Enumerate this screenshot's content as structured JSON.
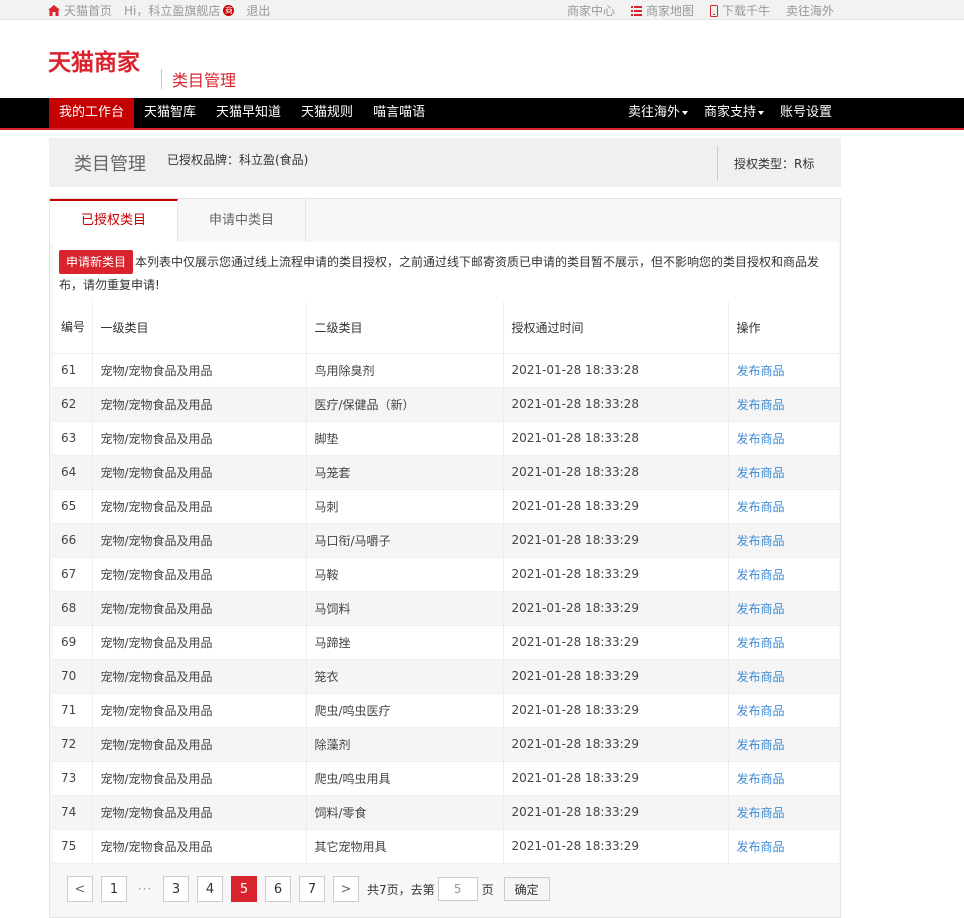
{
  "topbar": {
    "home": "天猫首页",
    "greeting": "Hi，科立盈旗舰店",
    "badge": "商",
    "logout": "退出",
    "links": [
      "商家中心",
      "商家地图",
      "下载千牛",
      "卖往海外"
    ]
  },
  "header": {
    "logo": "天猫商家",
    "subtitle": "类目管理"
  },
  "nav": {
    "left": [
      "我的工作台",
      "天猫智库",
      "天猫早知道",
      "天猫规则",
      "喵言喵语"
    ],
    "right": [
      "卖往海外",
      "商家支持",
      "账号设置"
    ]
  },
  "page": {
    "title": "类目管理",
    "brand": "已授权品牌：科立盈(食品)",
    "auth_type": "授权类型：R标"
  },
  "tabs": [
    "已授权类目",
    "申请中类目"
  ],
  "notice": {
    "button": "申请新类目",
    "text": "本列表中仅展示您通过线上流程申请的类目授权，之前通过线下邮寄资质已申请的类目暂不展示，但不影响您的类目授权和商品发布，请勿重复申请!"
  },
  "table": {
    "headers": [
      "编号",
      "一级类目",
      "二级类目",
      "授权通过时间",
      "操作"
    ],
    "rows": [
      {
        "no": "61",
        "l1": "宠物/宠物食品及用品",
        "l2": "鸟用除臭剂",
        "time": "2021-01-28 18:33:28",
        "action": "发布商品"
      },
      {
        "no": "62",
        "l1": "宠物/宠物食品及用品",
        "l2": "医疗/保健品（新）",
        "time": "2021-01-28 18:33:28",
        "action": "发布商品"
      },
      {
        "no": "63",
        "l1": "宠物/宠物食品及用品",
        "l2": "脚垫",
        "time": "2021-01-28 18:33:28",
        "action": "发布商品"
      },
      {
        "no": "64",
        "l1": "宠物/宠物食品及用品",
        "l2": "马笼套",
        "time": "2021-01-28 18:33:28",
        "action": "发布商品"
      },
      {
        "no": "65",
        "l1": "宠物/宠物食品及用品",
        "l2": "马刺",
        "time": "2021-01-28 18:33:29",
        "action": "发布商品"
      },
      {
        "no": "66",
        "l1": "宠物/宠物食品及用品",
        "l2": "马口衔/马嚼子",
        "time": "2021-01-28 18:33:29",
        "action": "发布商品"
      },
      {
        "no": "67",
        "l1": "宠物/宠物食品及用品",
        "l2": "马鞍",
        "time": "2021-01-28 18:33:29",
        "action": "发布商品"
      },
      {
        "no": "68",
        "l1": "宠物/宠物食品及用品",
        "l2": "马饲料",
        "time": "2021-01-28 18:33:29",
        "action": "发布商品"
      },
      {
        "no": "69",
        "l1": "宠物/宠物食品及用品",
        "l2": "马蹄挫",
        "time": "2021-01-28 18:33:29",
        "action": "发布商品"
      },
      {
        "no": "70",
        "l1": "宠物/宠物食品及用品",
        "l2": "笼衣",
        "time": "2021-01-28 18:33:29",
        "action": "发布商品"
      },
      {
        "no": "71",
        "l1": "宠物/宠物食品及用品",
        "l2": "爬虫/鸣虫医疗",
        "time": "2021-01-28 18:33:29",
        "action": "发布商品"
      },
      {
        "no": "72",
        "l1": "宠物/宠物食品及用品",
        "l2": "除藻剂",
        "time": "2021-01-28 18:33:29",
        "action": "发布商品"
      },
      {
        "no": "73",
        "l1": "宠物/宠物食品及用品",
        "l2": "爬虫/鸣虫用具",
        "time": "2021-01-28 18:33:29",
        "action": "发布商品"
      },
      {
        "no": "74",
        "l1": "宠物/宠物食品及用品",
        "l2": "饲料/零食",
        "time": "2021-01-28 18:33:29",
        "action": "发布商品"
      },
      {
        "no": "75",
        "l1": "宠物/宠物食品及用品",
        "l2": "其它宠物用具",
        "time": "2021-01-28 18:33:29",
        "action": "发布商品"
      }
    ]
  },
  "pager": {
    "prev": "<",
    "next": ">",
    "first": "1",
    "dots": "···",
    "pages": [
      "3",
      "4",
      "5",
      "6",
      "7"
    ],
    "current": "5",
    "total_prefix": "共7页，去第",
    "input_value": "5",
    "suffix": "页",
    "confirm": "确定"
  },
  "colors": {
    "brand_red": "#d9232d",
    "link_blue": "#3b8bd6",
    "nav_bg": "#000000"
  }
}
